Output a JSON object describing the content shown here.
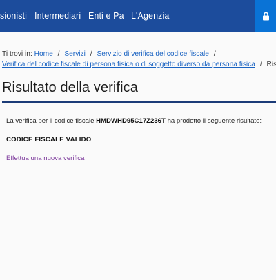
{
  "nav": {
    "items": [
      {
        "label": "sionisti"
      },
      {
        "label": "Intermediari"
      },
      {
        "label": "Enti e Pa"
      },
      {
        "label": "L'Agenzia"
      }
    ],
    "lock_icon": "lock-icon"
  },
  "breadcrumb": {
    "prefix": "Ti trovi in:",
    "items": [
      {
        "label": "Home"
      },
      {
        "label": "Servizi"
      },
      {
        "label": "Servizio di verifica del codice fiscale"
      },
      {
        "label": "Verifica del codice fiscale di persona fisica o di soggetto diverso da persona fisica"
      }
    ],
    "current": "Risultato",
    "separator": "/"
  },
  "page": {
    "title": "Risultato della verifica"
  },
  "result": {
    "text_before": "La verifica per il codice fiscale",
    "codice_fiscale": "HMDWHD95C17Z236T",
    "text_after": "ha prodotto il seguente risultato:",
    "status": "CODICE FISCALE VALIDO"
  },
  "actions": {
    "new_check_link": "Effettua una nuova verifica"
  },
  "colors": {
    "header_bg": "#1c4c9c",
    "lock_bg": "#0a73d6",
    "link": "#1a63c2",
    "visited_link": "#7d3a9c",
    "title_rule": "#1c3c78"
  }
}
